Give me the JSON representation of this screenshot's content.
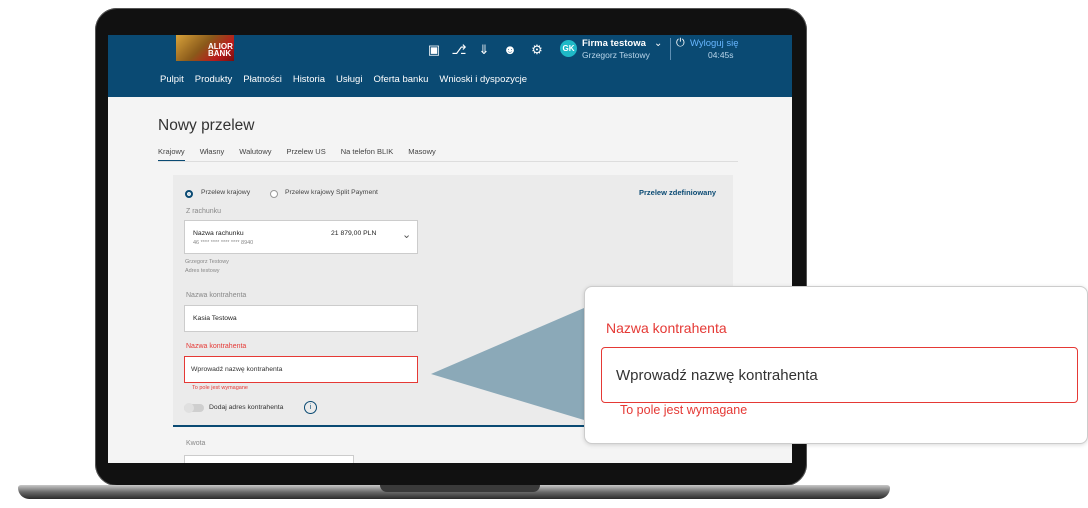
{
  "header": {
    "logo_text": "ALIOR BANK",
    "icons": [
      "document-icon",
      "bell-icon",
      "download-icon",
      "user-icon",
      "settings-icon"
    ],
    "avatar_initials": "GK",
    "company_name": "Firma testowa",
    "user_name": "Grzegorz Testowy",
    "logout_label": "Wyloguj się",
    "session_timer": "04:45s"
  },
  "nav": {
    "items": [
      "Pulpit",
      "Produkty",
      "Płatności",
      "Historia",
      "Usługi",
      "Oferta banku",
      "Wnioski i dyspozycje"
    ]
  },
  "page": {
    "title": "Nowy przelew",
    "tabs": [
      "Krajowy",
      "Własny",
      "Walutowy",
      "Przelew US",
      "Na telefon BLIK",
      "Masowy"
    ],
    "active_tab": "Krajowy"
  },
  "form": {
    "radio_domestic": "Przelew krajowy",
    "radio_split": "Przelew krajowy Split Payment",
    "predefined_link": "Przelew zdefiniowany",
    "from_account_label": "Z rachunku",
    "account_name": "Nazwa rachunku",
    "account_number": "46 **** **** **** **** 8940",
    "account_balance": "21 879,00 PLN",
    "owner_name": "Grzegorz Testowy",
    "owner_address": "Adres testowy",
    "contractor_label": "Nazwa kontrahenta",
    "contractor_value": "Kasia Testowa",
    "contractor_error_label": "Nazwa kontrahenta",
    "contractor_error_placeholder": "Wprowadź nazwę kontrahenta",
    "required_error": "To pole jest wymagane",
    "add_address_label": "Dodaj adres kontrahenta",
    "amount_label": "Kwota"
  },
  "callout": {
    "label": "Nazwa kontrahenta",
    "placeholder": "Wprowadź nazwę kontrahenta",
    "error": "To pole jest wymagane"
  },
  "colors": {
    "header_bg": "#0a4a73",
    "error": "#e53935",
    "avatar": "#1fb9c7",
    "link": "#0a4a73"
  }
}
